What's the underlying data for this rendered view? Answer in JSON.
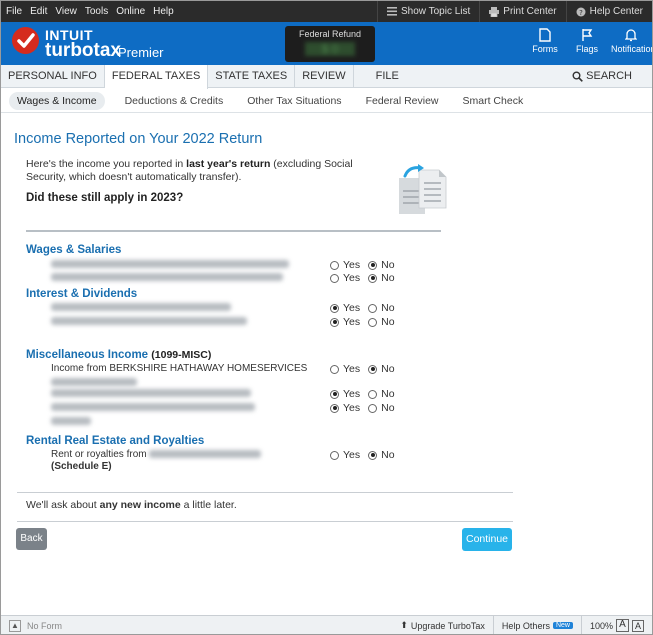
{
  "menubar": {
    "items": [
      "File",
      "Edit",
      "View",
      "Tools",
      "Online",
      "Help"
    ],
    "show_topic_list": "Show Topic List",
    "print_center": "Print Center",
    "help_center": "Help Center"
  },
  "brand": {
    "intuit": "INTUIT",
    "turbotax": "turbotax",
    "edition": "Premier",
    "refund_label": "Federal Refund",
    "refund_amount": "$ 0",
    "forms_label": "Forms",
    "flags_label": "Flags",
    "notifications_label": "Notifications"
  },
  "main_tabs": [
    {
      "label": "PERSONAL INFO"
    },
    {
      "label": "FEDERAL TAXES"
    },
    {
      "label": "STATE TAXES"
    },
    {
      "label": "REVIEW"
    },
    {
      "label": "FILE"
    }
  ],
  "active_main_tab": "FEDERAL TAXES",
  "search_label": "SEARCH",
  "sub_tabs": [
    {
      "label": "Wages & Income"
    },
    {
      "label": "Deductions & Credits"
    },
    {
      "label": "Other Tax Situations"
    },
    {
      "label": "Federal Review"
    },
    {
      "label": "Smart Check"
    }
  ],
  "page": {
    "title": "Income Reported on Your 2022 Return",
    "intro_prefix": "Here's the income you reported in ",
    "intro_bold": "last year's return",
    "intro_suffix": " (excluding Social Security, which doesn't automatically transfer).",
    "question": "Did these still apply in 2023?",
    "yes_label": "Yes",
    "no_label": "No"
  },
  "sections": [
    {
      "heading": "Wages & Salaries",
      "heading_suffix": "",
      "rows": [
        {
          "label": "",
          "answer": "no"
        },
        {
          "label": "",
          "answer": "no"
        }
      ]
    },
    {
      "heading": "Interest & Dividends",
      "heading_suffix": "",
      "rows": [
        {
          "label": "",
          "answer": "yes"
        },
        {
          "label": "",
          "answer": "yes"
        }
      ]
    },
    {
      "heading": "Miscellaneous Income",
      "heading_suffix": "(1099-MISC)",
      "rows": [
        {
          "label": "Income from BERKSHIRE HATHAWAY HOMESERVICES",
          "answer": "no"
        },
        {
          "label": "",
          "answer": "yes"
        },
        {
          "label": "",
          "answer": "yes"
        }
      ]
    },
    {
      "heading": "Rental Real Estate and Royalties",
      "heading_suffix": "",
      "rows": [
        {
          "label": "Rent or royalties from",
          "label_bold": "(Schedule E)",
          "answer": "no"
        }
      ]
    }
  ],
  "footer_note": {
    "prefix": "We'll ask about ",
    "bold": "any new income",
    "suffix": " a little later."
  },
  "buttons": {
    "back": "Back",
    "continue": "Continue"
  },
  "statusbar": {
    "no_form": "No Form",
    "upgrade": "Upgrade TurboTax",
    "help_others": "Help Others",
    "new_badge": "New",
    "zoom": "100%",
    "font_large": "A",
    "font_small": "A"
  },
  "colors": {
    "brand_blue": "#0e6cc4",
    "heading_blue": "#1a6fb0",
    "continue_blue": "#28b3ea",
    "back_gray": "#7b8289",
    "logo_red": "#d52b1e"
  }
}
